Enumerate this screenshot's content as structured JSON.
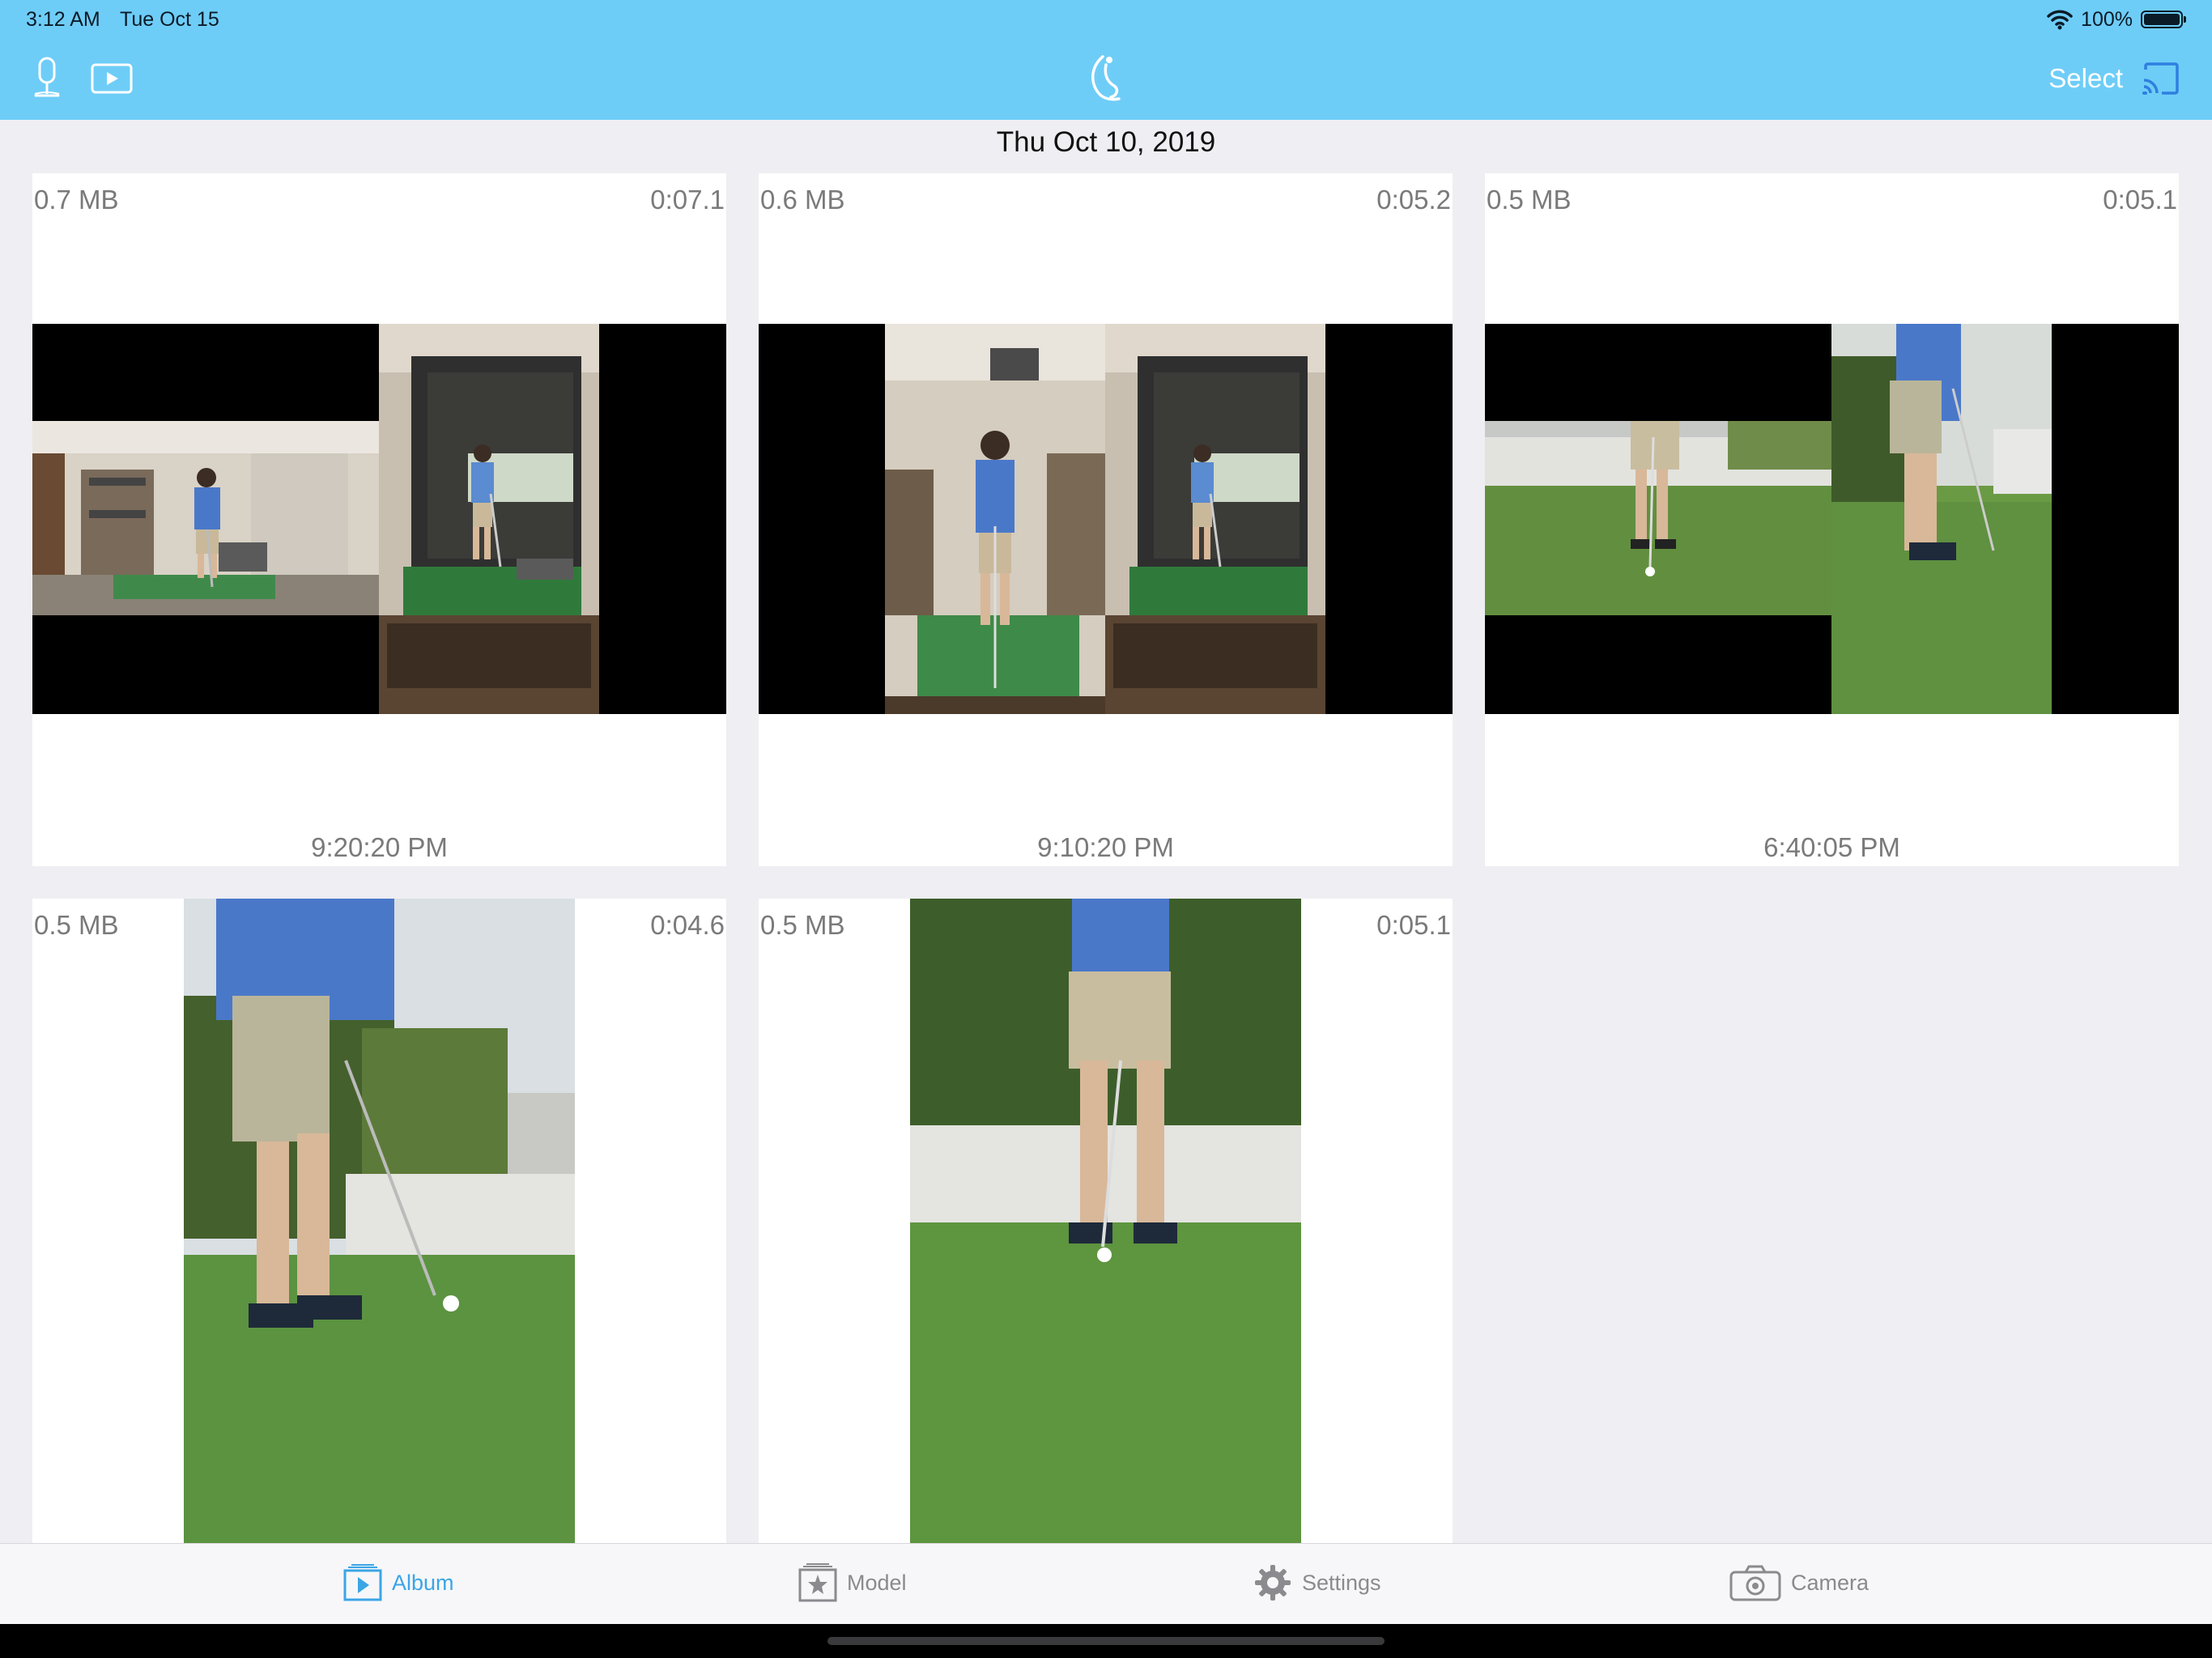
{
  "status_bar": {
    "time": "3:12 AM",
    "date": "Tue Oct 15",
    "battery": "100%"
  },
  "nav": {
    "select_label": "Select"
  },
  "section": {
    "date": "Thu Oct 10, 2019"
  },
  "videos": [
    {
      "size": "0.7 MB",
      "duration": "0:07.1",
      "time": "9:20:20 PM"
    },
    {
      "size": "0.6 MB",
      "duration": "0:05.2",
      "time": "9:10:20 PM"
    },
    {
      "size": "0.5 MB",
      "duration": "0:05.1",
      "time": "6:40:05 PM"
    },
    {
      "size": "0.5 MB",
      "duration": "0:04.6"
    },
    {
      "size": "0.5 MB",
      "duration": "0:05.1"
    }
  ],
  "tabs": [
    {
      "label": "Album",
      "icon": "album-icon"
    },
    {
      "label": "Model",
      "icon": "model-icon"
    },
    {
      "label": "Settings",
      "icon": "settings-gear-icon"
    },
    {
      "label": "Camera",
      "icon": "camera-icon"
    }
  ],
  "colors": {
    "nav_bar": "#6ecdf7",
    "accent": "#3ba5e6",
    "meta_text": "#7a7a7a"
  }
}
